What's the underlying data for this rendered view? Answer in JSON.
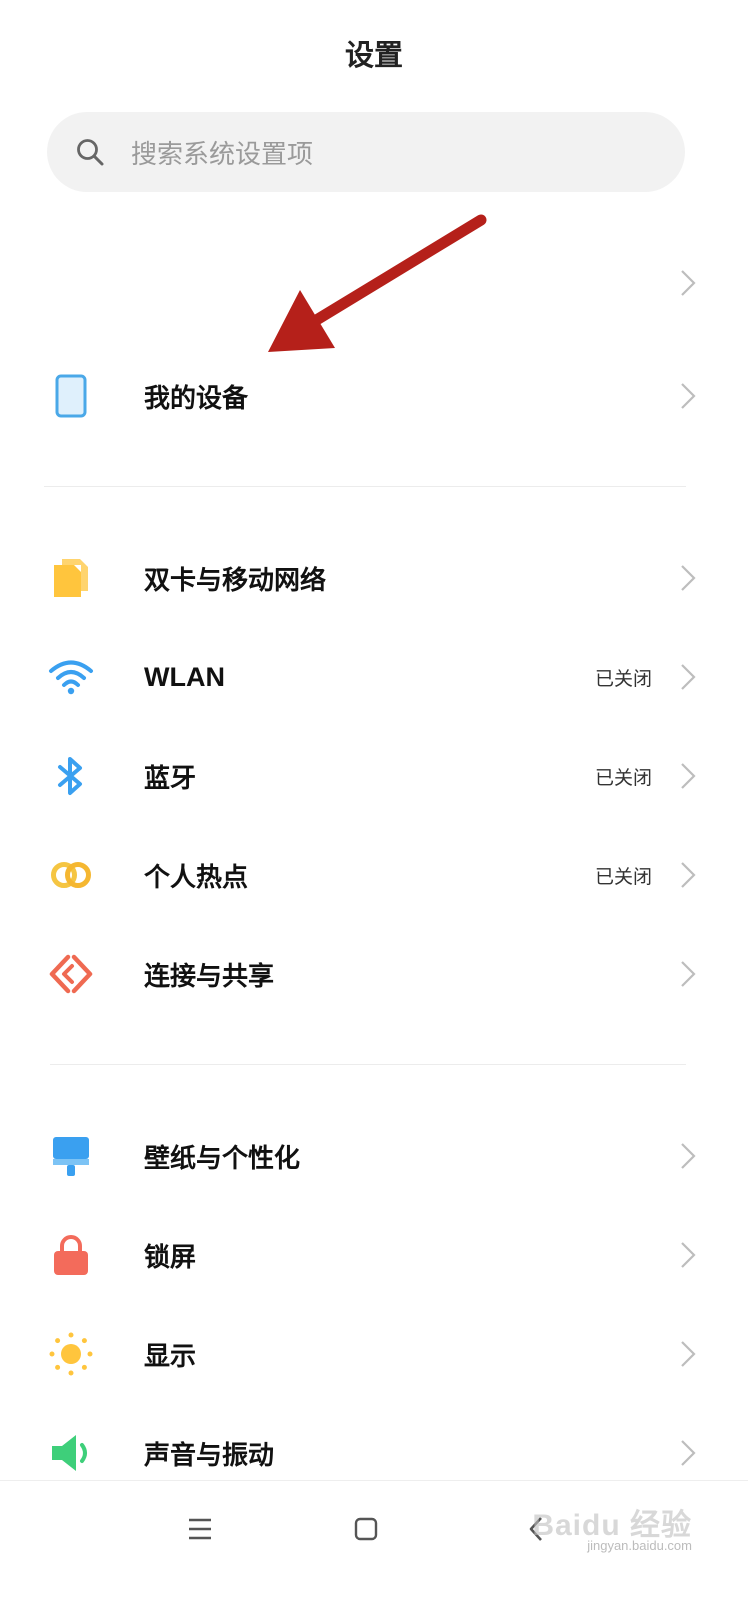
{
  "header": {
    "title": "设置"
  },
  "search": {
    "placeholder": "搜索系统设置项"
  },
  "sections": [
    {
      "items": [
        {
          "label": "",
          "status": "",
          "icon": ""
        },
        {
          "label": "我的设备",
          "status": "",
          "icon": "phone-device-icon"
        }
      ]
    },
    {
      "items": [
        {
          "label": "双卡与移动网络",
          "status": "",
          "icon": "sim-card-icon"
        },
        {
          "label": "WLAN",
          "status": "已关闭",
          "icon": "wifi-icon"
        },
        {
          "label": "蓝牙",
          "status": "已关闭",
          "icon": "bluetooth-icon"
        },
        {
          "label": "个人热点",
          "status": "已关闭",
          "icon": "hotspot-icon"
        },
        {
          "label": "连接与共享",
          "status": "",
          "icon": "connection-share-icon"
        }
      ]
    },
    {
      "items": [
        {
          "label": "壁纸与个性化",
          "status": "",
          "icon": "wallpaper-icon"
        },
        {
          "label": "锁屏",
          "status": "",
          "icon": "lock-icon"
        },
        {
          "label": "显示",
          "status": "",
          "icon": "sun-icon"
        },
        {
          "label": "声音与振动",
          "status": "",
          "icon": "speaker-icon"
        }
      ]
    }
  ],
  "navbar": {
    "icons": [
      "menu-icon",
      "home-square-icon",
      "back-icon"
    ]
  },
  "watermark": {
    "text": "Baidu 经验",
    "sub": "jingyan.baidu.com"
  },
  "colors": {
    "arrow": "#b5201a",
    "device": "#4aa8e8",
    "sim": "#ffc53d",
    "wifi": "#3aa0f0",
    "hotspot": "#f5c542",
    "share": "#ef6a52",
    "wallpaper": "#3aa0f0",
    "lock": "#f36b5b",
    "sun": "#ffc53d",
    "sound": "#3ecf7a"
  }
}
